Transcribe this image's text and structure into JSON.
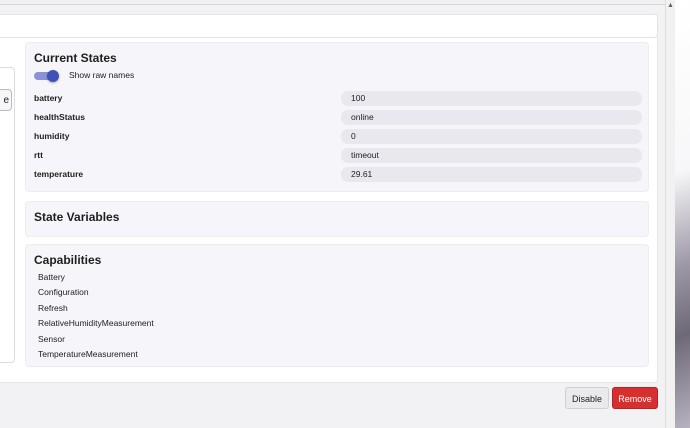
{
  "left": {
    "partial_button_label": "e"
  },
  "current_states": {
    "title": "Current States",
    "toggle_label": "Show raw names",
    "rows": [
      {
        "name": "battery",
        "value": "100"
      },
      {
        "name": "healthStatus",
        "value": "online"
      },
      {
        "name": "humidity",
        "value": "0"
      },
      {
        "name": "rtt",
        "value": "timeout"
      },
      {
        "name": "temperature",
        "value": "29.61"
      }
    ]
  },
  "state_variables": {
    "title": "State Variables"
  },
  "capabilities": {
    "title": "Capabilities",
    "items": [
      "Battery",
      "Configuration",
      "Refresh",
      "RelativeHumidityMeasurement",
      "Sensor",
      "TemperatureMeasurement"
    ]
  },
  "footer": {
    "disable_label": "Disable",
    "remove_label": "Remove"
  },
  "scrollbar": {
    "up_arrow": "▲"
  },
  "colors": {
    "accent": "#3f51b5",
    "danger": "#d62f2f"
  }
}
